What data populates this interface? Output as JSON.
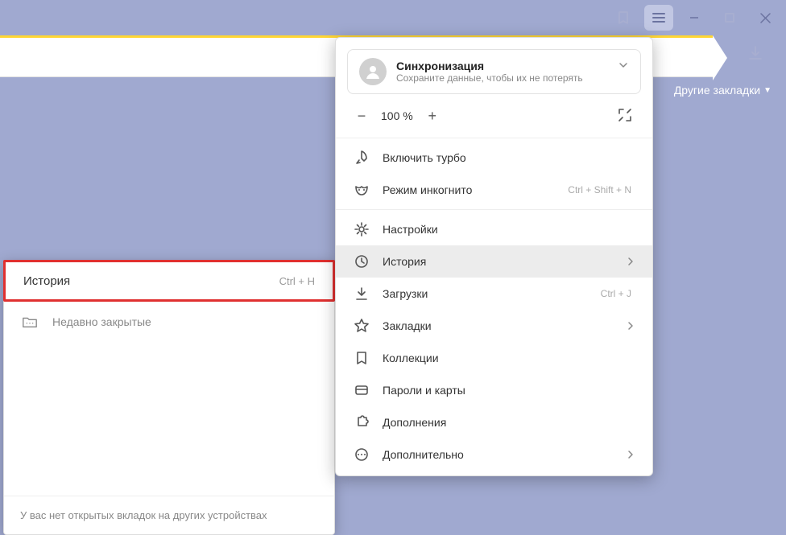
{
  "titlebar": {
    "bookmark_icon": "bookmark",
    "menu_icon": "hamburger",
    "min_icon": "minimize",
    "max_icon": "maximize",
    "close_icon": "close"
  },
  "download_icon": "download",
  "other_bookmarks_label": "Другие закладки",
  "submenu": {
    "header_label": "История",
    "header_shortcut": "Ctrl + H",
    "recent_label": "Недавно закрытые",
    "footer_text": "У вас нет открытых вкладок на других устройствах"
  },
  "menu": {
    "sync": {
      "title": "Синхронизация",
      "subtitle": "Сохраните данные, чтобы их не потерять"
    },
    "zoom": {
      "minus": "−",
      "value": "100 %",
      "plus": "+"
    },
    "items": [
      {
        "label": "Включить турбо",
        "shortcut": "",
        "arrow": false,
        "active": false,
        "icon": "rocket"
      },
      {
        "label": "Режим инкогнито",
        "shortcut": "Ctrl + Shift + N",
        "arrow": false,
        "active": false,
        "icon": "mask"
      },
      {
        "label": "Настройки",
        "shortcut": "",
        "arrow": false,
        "active": false,
        "icon": "gear"
      },
      {
        "label": "История",
        "shortcut": "",
        "arrow": true,
        "active": true,
        "icon": "clock"
      },
      {
        "label": "Загрузки",
        "shortcut": "Ctrl + J",
        "arrow": false,
        "active": false,
        "icon": "download"
      },
      {
        "label": "Закладки",
        "shortcut": "",
        "arrow": true,
        "active": false,
        "icon": "star"
      },
      {
        "label": "Коллекции",
        "shortcut": "",
        "arrow": false,
        "active": false,
        "icon": "bookmark"
      },
      {
        "label": "Пароли и карты",
        "shortcut": "",
        "arrow": false,
        "active": false,
        "icon": "card"
      },
      {
        "label": "Дополнения",
        "shortcut": "",
        "arrow": false,
        "active": false,
        "icon": "puzzle"
      },
      {
        "label": "Дополнительно",
        "shortcut": "",
        "arrow": true,
        "active": false,
        "icon": "dots"
      }
    ]
  }
}
